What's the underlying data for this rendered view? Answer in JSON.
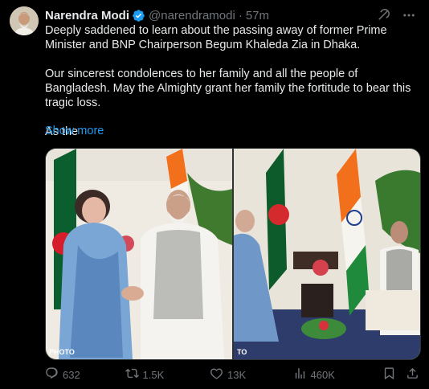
{
  "author": {
    "name": "Narendra Modi",
    "handle": "@narendramodi",
    "separator": "·",
    "time": "57m"
  },
  "post": {
    "line1": "Deeply saddened to learn about the passing away of former Prime Minister and BNP Chairperson Begum Khaleda Zia in Dhaka.",
    "line2": "Our sincerest condolences to her family and all the people of Bangladesh. May the Almighty grant her family the fortitude to bear this tragic loss.",
    "line3": "As the",
    "show_more": "Show more"
  },
  "media": {
    "credit_left": "PHOTO",
    "credit_right": "TO"
  },
  "actions": {
    "replies": "632",
    "reposts": "1.5K",
    "likes": "13K",
    "views": "460K"
  },
  "colors": {
    "link": "#1d9bf0",
    "muted": "#71767b",
    "verified": "#1d9bf0"
  }
}
